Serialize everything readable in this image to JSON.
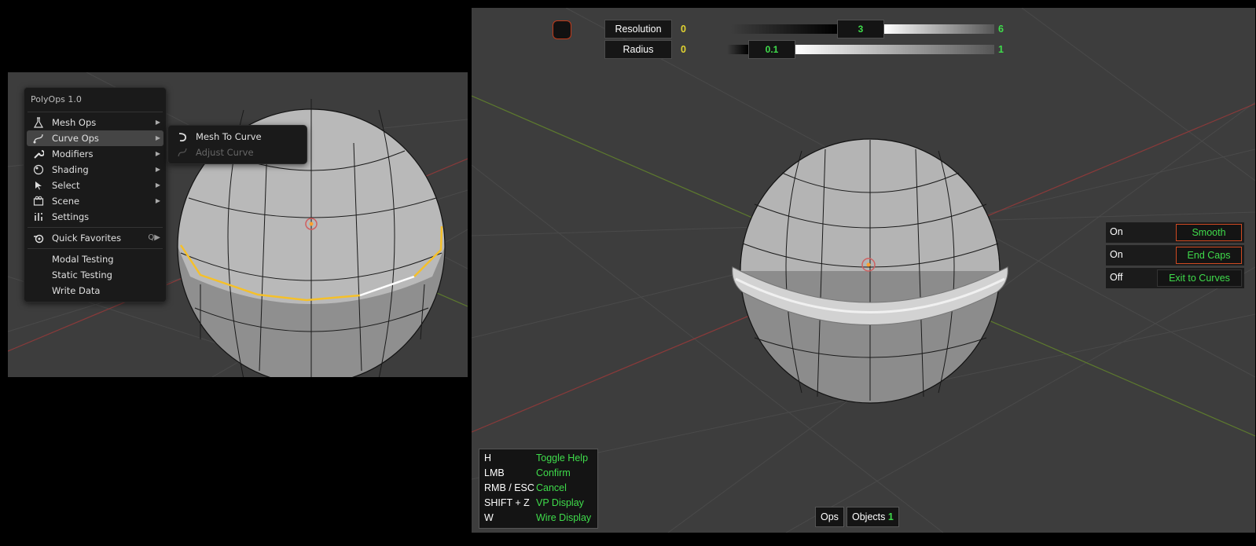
{
  "left_menu": {
    "title": "PolyOps 1.0",
    "items": [
      {
        "label": "Mesh Ops",
        "icon": "flask-icon",
        "submenu": true
      },
      {
        "label": "Curve Ops",
        "icon": "curve-icon",
        "submenu": true
      },
      {
        "label": "Modifiers",
        "icon": "wrench-icon",
        "submenu": true
      },
      {
        "label": "Shading",
        "icon": "shading-icon",
        "submenu": true
      },
      {
        "label": "Select",
        "icon": "cursor-icon",
        "submenu": true
      },
      {
        "label": "Scene",
        "icon": "scene-icon",
        "submenu": true
      },
      {
        "label": "Settings",
        "icon": "tools-icon",
        "submenu": false
      }
    ],
    "favorites": {
      "label": "Quick Favorites",
      "hotkey": "Q"
    },
    "extra_items": [
      "Modal Testing",
      "Static Testing",
      "Write Data"
    ]
  },
  "submenu": {
    "items": [
      {
        "label": "Mesh To Curve",
        "enabled": true
      },
      {
        "label": "Adjust Curve",
        "enabled": false
      }
    ]
  },
  "sliders": [
    {
      "label": "Resolution",
      "min": "0",
      "value": "3",
      "max": "6"
    },
    {
      "label": "Radius",
      "min": "0",
      "value": "0.1",
      "max": "1"
    }
  ],
  "toggles": [
    {
      "state": "On",
      "label": "Smooth"
    },
    {
      "state": "On",
      "label": "End Caps"
    },
    {
      "state": "Off",
      "label": "Exit to Curves"
    }
  ],
  "help": [
    {
      "key": "H",
      "action": "Toggle Help"
    },
    {
      "key": "LMB",
      "action": "Confirm"
    },
    {
      "key": "RMB / ESC",
      "action": "Cancel"
    },
    {
      "key": "SHIFT + Z",
      "action": "VP Display"
    },
    {
      "key": "W",
      "action": "Wire Display"
    }
  ],
  "status": {
    "ops_label": "Ops",
    "objects_label": "Objects",
    "objects_count": "1"
  },
  "colors": {
    "accent_green": "#3fdc4b",
    "value_yellow": "#e2d431",
    "border_orange": "#d04a22"
  }
}
